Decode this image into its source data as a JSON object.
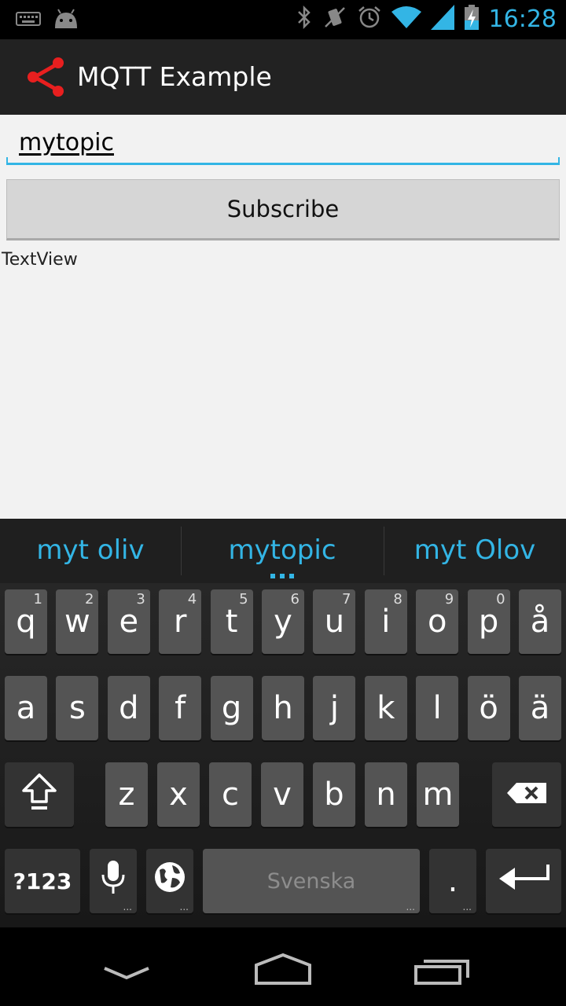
{
  "status_bar": {
    "time": "16:28",
    "icons": [
      "keyboard-icon",
      "android-icon",
      "bluetooth-icon",
      "vibrate-mute-icon",
      "alarm-icon",
      "wifi-icon",
      "signal-icon",
      "battery-charging-icon"
    ]
  },
  "action_bar": {
    "title": "MQTT Example",
    "icon": "share-icon",
    "accent": "#e81f1f"
  },
  "main": {
    "topic_value": "mytopic",
    "subscribe_label": "Subscribe",
    "textview_text": "TextView"
  },
  "keyboard": {
    "suggestions": [
      "myt oliv",
      "mytopic",
      "myt Olov"
    ],
    "row1": [
      {
        "k": "q",
        "h": "1"
      },
      {
        "k": "w",
        "h": "2"
      },
      {
        "k": "e",
        "h": "3"
      },
      {
        "k": "r",
        "h": "4"
      },
      {
        "k": "t",
        "h": "5"
      },
      {
        "k": "y",
        "h": "6"
      },
      {
        "k": "u",
        "h": "7"
      },
      {
        "k": "i",
        "h": "8"
      },
      {
        "k": "o",
        "h": "9"
      },
      {
        "k": "p",
        "h": "0"
      },
      {
        "k": "å",
        "h": ""
      }
    ],
    "row2": [
      "a",
      "s",
      "d",
      "f",
      "g",
      "h",
      "j",
      "k",
      "l",
      "ö",
      "ä"
    ],
    "row3": [
      "z",
      "x",
      "c",
      "v",
      "b",
      "n",
      "m"
    ],
    "symbols_label": "?123",
    "space_label": "Svenska",
    "period_label": ".",
    "accent": "#33b5e5"
  },
  "nav_bar": {
    "icons": [
      "back-icon",
      "home-icon",
      "recent-apps-icon"
    ]
  }
}
